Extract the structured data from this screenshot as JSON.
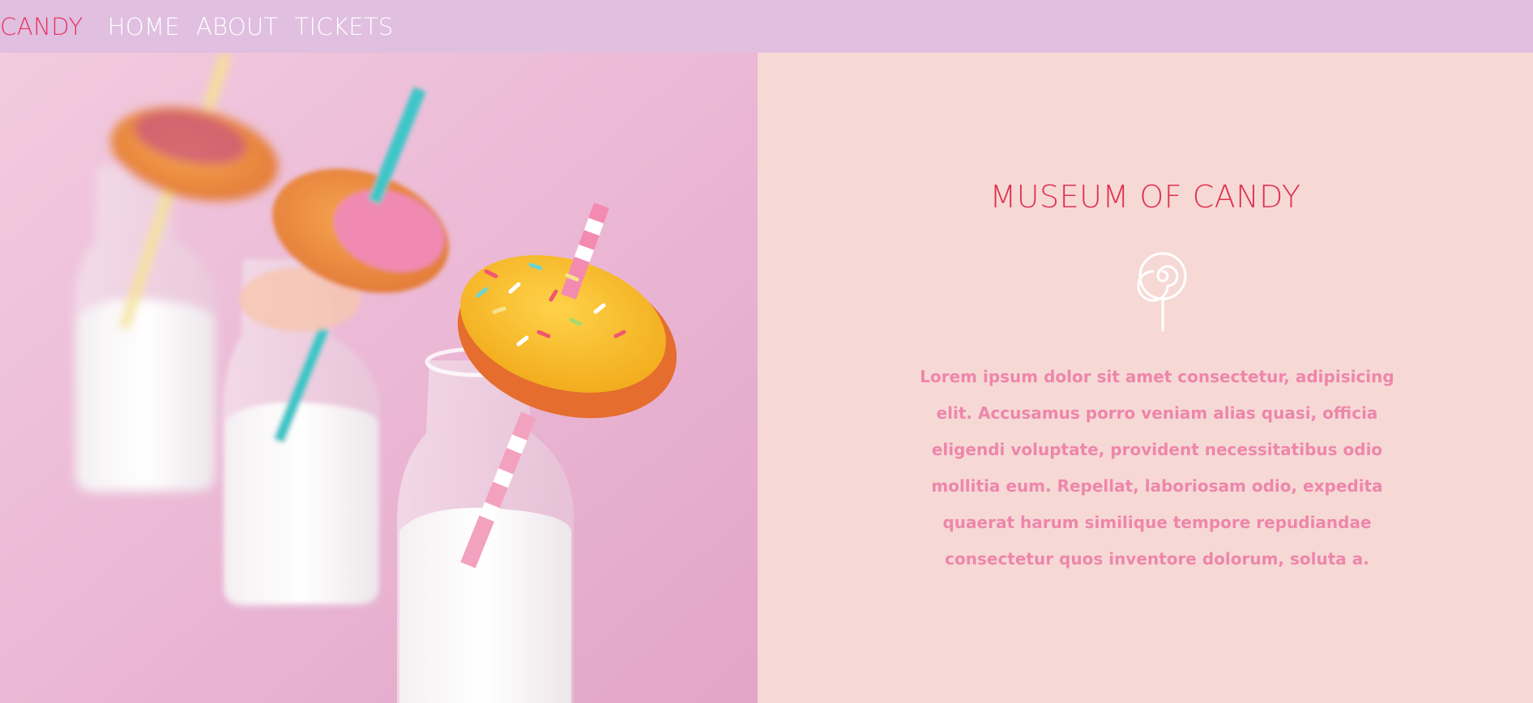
{
  "nav": {
    "brand": "CANDY",
    "links": [
      {
        "label": "HOME"
      },
      {
        "label": "ABOUT"
      },
      {
        "label": "TICKETS"
      }
    ]
  },
  "hero": {
    "image_icon": "donuts-and-milk-bottles-photo"
  },
  "info": {
    "title": "MUSEUM OF CANDY",
    "icon": "lollipop-icon",
    "description": "Lorem ipsum dolor sit amet consectetur, adipisicing elit. Accusamus porro veniam alias quasi, officia eligendi voluptate, provident necessitatibus odio mollitia eum. Repellat, laboriosam odio, expedita quaerat harum similique tempore repudiandae consectetur quos inventore dolorum, soluta a."
  },
  "colors": {
    "navbar_bg": "#e0bfe0",
    "brand": "#e8345e",
    "nav_link": "#ffffff",
    "panel_bg": "#f6d9d5",
    "title": "#e0314f",
    "description": "#ee86ab"
  }
}
